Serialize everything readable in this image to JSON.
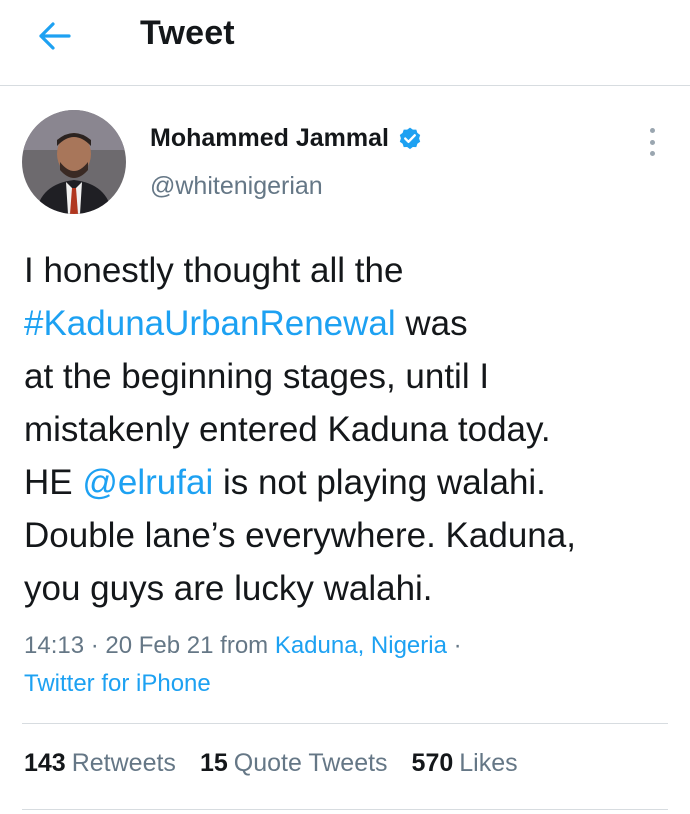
{
  "header": {
    "back_icon": "arrow-left-icon",
    "title": "Tweet"
  },
  "colors": {
    "accent": "#1da1f2",
    "text": "#14171a",
    "muted": "#657786",
    "divider": "#d7dce0"
  },
  "author": {
    "name": "Mohammed Jammal",
    "handle": "@whitenigerian",
    "verified": true,
    "verified_icon": "verified-badge-icon",
    "menu_icon": "more-vertical-icon"
  },
  "tweet": {
    "line1": "I honestly thought all the",
    "hashtag": "#KadunaUrbanRenewal",
    "line2_rest": " was",
    "line3": "at the beginning stages, until I",
    "line4": "mistakenly entered Kaduna today.",
    "line5_pre": "HE ",
    "mention": "@elrufai",
    "line5_post": " is not playing walahi.",
    "line6": "Double lane’s everywhere. Kaduna,",
    "line7": "you guys are lucky walahi."
  },
  "meta": {
    "time": "14:13",
    "sep1": " · ",
    "date": "20 Feb 21",
    "from_label": " from ",
    "location": "Kaduna, Nigeria",
    "sep2": " ·",
    "source": "Twitter for iPhone"
  },
  "stats": {
    "retweets_count": "143",
    "retweets_label": "Retweets",
    "quotes_count": "15",
    "quotes_label": "Quote Tweets",
    "likes_count": "570",
    "likes_label": "Likes"
  }
}
